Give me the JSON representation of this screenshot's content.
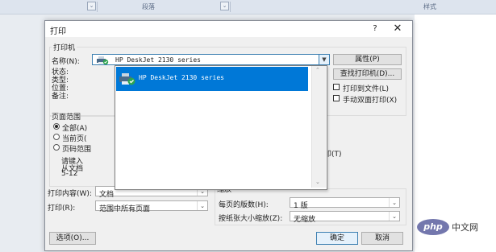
{
  "ribbon": {
    "group_paragraph": "段落",
    "group_styles": "样式"
  },
  "dialog": {
    "title": "打印",
    "help": "?",
    "close": "✕",
    "printer_group": "打印机",
    "name_label": "名称(N):",
    "printer_name": "HP DeskJet 2130 series",
    "status_label": "状态:",
    "type_label": "类型:",
    "where_label": "位置:",
    "comment_label": "备注:",
    "properties_button": "属性(P)",
    "find_printer_button": "查找打印机(D)...",
    "print_to_file": "打印到文件(L)",
    "manual_duplex": "手动双面打印(X)",
    "page_range_group": "页面范围",
    "range_all": "全部(A)",
    "range_current": "当前页(",
    "range_pages": "页码范围",
    "range_hint_1": "请键入",
    "range_hint_2": "从文档",
    "range_hint_3": "5-12 ",
    "print_to_cut": "印(T)",
    "print_what_label": "打印内容(W):",
    "print_what_value": "文档",
    "print_label": "打印(R):",
    "print_value": "范围中所有页面",
    "zoom_group": "缩放",
    "pages_per_sheet_label": "每页的版数(H):",
    "pages_per_sheet_value": "1 版",
    "scale_label": "按纸张大小缩放(Z):",
    "scale_value": "无缩放",
    "options_button": "选项(O)...",
    "ok_button": "确定",
    "cancel_button": "取消"
  },
  "dropdown": {
    "items": [
      "HP DeskJet 2130 series"
    ],
    "selected_index": 0
  },
  "watermark": {
    "logo": "php",
    "text": "中文网"
  },
  "colors": {
    "selection": "#0078d7",
    "dialog_bg": "#f0f0f0",
    "php_logo": "#7377ad"
  }
}
